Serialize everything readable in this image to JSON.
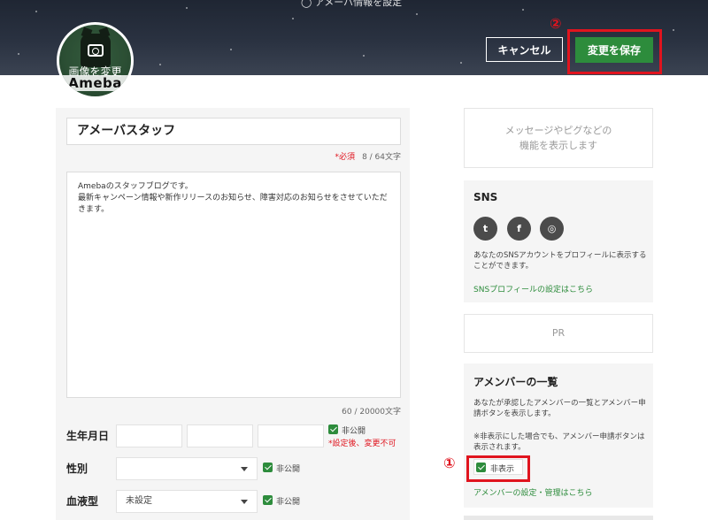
{
  "header": {
    "top_text": "◯ アメーバ情報を設定",
    "cancel_label": "キャンセル",
    "save_label": "変更を保存",
    "annotation_2": "②"
  },
  "avatar": {
    "change_label": "画像を変更",
    "logo_text": "Ameba"
  },
  "profile": {
    "name_value": "アメーバスタッフ",
    "required_label": "*必須",
    "name_count": "8 / 64文字",
    "bio_lines": [
      "Amebaのスタッフブログです。",
      "最新キャンペーン情報や新作リリースのお知らせ、障害対応のお知らせをさせていただきます。"
    ],
    "bio_count": "60 / 20000文字"
  },
  "fields": {
    "birthday_label": "生年月日",
    "birthday_private": "非公開",
    "birthday_note": "*設定後、変更不可",
    "gender_label": "性別",
    "gender_value": "",
    "gender_private": "非公開",
    "blood_label": "血液型",
    "blood_value": "未設定",
    "blood_private": "非公開"
  },
  "sidebar": {
    "message_lines": [
      "メッセージやピグなどの",
      "機能を表示します"
    ],
    "sns_title": "SNS",
    "sns_icons": [
      "twitter-icon",
      "facebook-icon",
      "instagram-icon"
    ],
    "sns_desc": "あなたのSNSアカウントをプロフィールに表示することができます。",
    "sns_link": "SNSプロフィールの設定はこちら",
    "pr_label": "PR",
    "members_title": "アメンバーの一覧",
    "members_desc": "あなたが承認したアメンバーの一覧とアメンバー申請ボタンを表示します。",
    "members_note": "※非表示にした場合でも、アメンバー申請ボタンは表示されます。",
    "hide_label": "非表示",
    "members_link": "アメンバーの設定・管理はこちら",
    "annotation_1": "①"
  },
  "colors": {
    "accent_green": "#2d8c3c",
    "annotation_red": "#e0141e"
  }
}
